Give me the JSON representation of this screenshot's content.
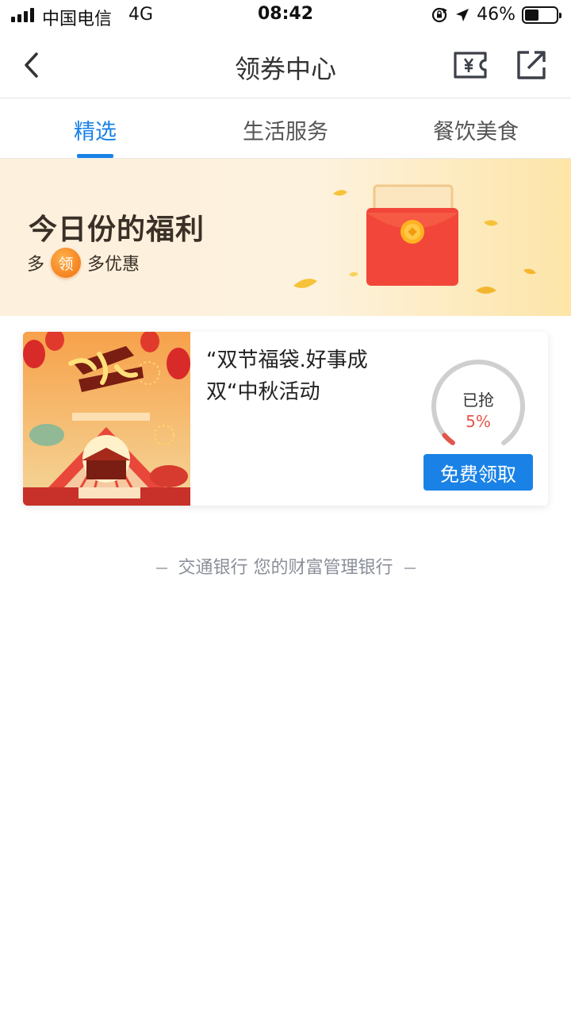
{
  "status_bar": {
    "carrier": "中国电信",
    "network": "4G",
    "time": "08:42",
    "battery_percent": "46%",
    "battery_level": 0.46,
    "icons": [
      "signal-icon",
      "rotation-lock-icon",
      "location-arrow-icon",
      "battery-icon"
    ]
  },
  "nav": {
    "title": "领券中心",
    "back_icon": "chevron-left-icon",
    "coupon_icon": "yen-ticket-icon",
    "share_icon": "share-icon"
  },
  "tabs": [
    {
      "label": "精选",
      "active": true
    },
    {
      "label": "生活服务",
      "active": false
    },
    {
      "label": "餐饮美食",
      "active": false
    }
  ],
  "banner": {
    "title": "今日份的福利",
    "sub_before": "多",
    "badge": "领",
    "sub_after": "多优惠",
    "image": "red-envelope-illustration"
  },
  "coupon": {
    "title": "“双节福袋.好事成双“中秋活动",
    "image": "mid-autumn-national-day-poster",
    "gauge_label": "已抢",
    "gauge_value": "5%",
    "progress": 0.05,
    "button_label": "免费领取",
    "accent": "#1a82e6"
  },
  "footer": {
    "text": "交通银行 您的财富管理银行"
  }
}
